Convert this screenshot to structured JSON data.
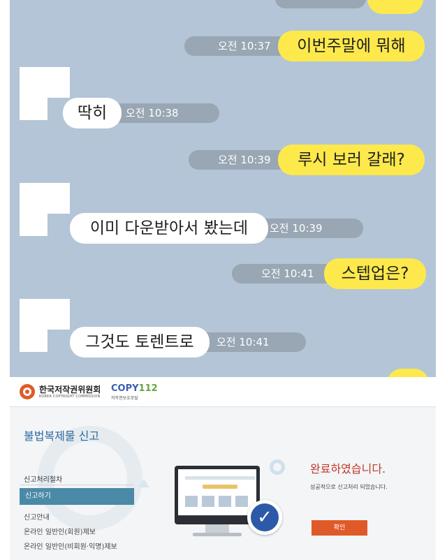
{
  "chat": {
    "messages": [
      {
        "from": "me",
        "text": "이번주말에 뭐해",
        "time": "오전 10:37"
      },
      {
        "from": "other",
        "text": "딱히",
        "time": "오전 10:38"
      },
      {
        "from": "me",
        "text": "루시 보러 갈래?",
        "time": "오전 10:39"
      },
      {
        "from": "other",
        "text": "이미 다운받아서 봤는데",
        "time": "오전 10:39"
      },
      {
        "from": "me",
        "text": "스텝업은?",
        "time": "오전 10:41"
      },
      {
        "from": "other",
        "text": "그것도 토렌트로",
        "time": "오전 10:41"
      }
    ],
    "colors": {
      "me": "#fde94b",
      "other": "#ffffff",
      "background": "#b3c5d6"
    }
  },
  "report": {
    "org_name": "한국저작권위원회",
    "org_sub": "KOREA COPYRIGHT COMMISSION",
    "brand": "COPY",
    "brand_num": "112",
    "brand_sub": "저작권보호포털",
    "page_title": "불법복제물 신고",
    "sidebar": {
      "heading": "신고처리절차",
      "active": "신고하기",
      "items": [
        "신고안내",
        "온라인 일반인(회원)제보",
        "온라인 일반인(비회원·익명)제보"
      ]
    },
    "result_title": "완료하였습니다.",
    "result_message": "성공적으로 신고처리 되었습니다.",
    "confirm_label": "확인",
    "accent_color": "#e05a29"
  }
}
